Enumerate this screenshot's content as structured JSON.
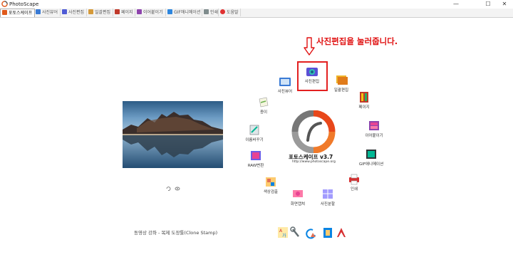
{
  "window": {
    "title": "PhotoScape"
  },
  "tabs": [
    {
      "label": "포토스케이프",
      "icon": "home-icon",
      "color": "#e05a1c"
    },
    {
      "label": "사진뷰어",
      "icon": "viewer-icon",
      "color": "#3a7bd5"
    },
    {
      "label": "사진편집",
      "icon": "editor-icon",
      "color": "#4f5bd5"
    },
    {
      "label": "일괄편집",
      "icon": "batch-icon",
      "color": "#d59a3a"
    },
    {
      "label": "페이지",
      "icon": "page-icon",
      "color": "#c0392b"
    },
    {
      "label": "이어붙이기",
      "icon": "combine-icon",
      "color": "#8e44ad"
    },
    {
      "label": "GIF애니메이션",
      "icon": "gif-icon",
      "color": "#2e86de"
    },
    {
      "label": "인쇄",
      "icon": "print-icon",
      "color": "#7f8c8d"
    },
    {
      "label": "도움말",
      "icon": "help-icon",
      "color": "#e03131"
    }
  ],
  "annotation": {
    "text": "사진편집을 눌러줍니다.",
    "color": "#e01010"
  },
  "center": {
    "title": "포토스케이프 v3.7",
    "url": "http://www.photoscape.org"
  },
  "wheel_items": [
    {
      "key": "viewer",
      "label": "사진뷰어",
      "icon": "viewer-icon"
    },
    {
      "key": "editor",
      "label": "사진편집",
      "icon": "photo-editor-icon"
    },
    {
      "key": "batch",
      "label": "일괄편집",
      "icon": "batch-editor-icon"
    },
    {
      "key": "page",
      "label": "페이지",
      "icon": "page-icon"
    },
    {
      "key": "combine",
      "label": "이어붙이기",
      "icon": "combine-icon"
    },
    {
      "key": "gif",
      "label": "GIF애니메이션",
      "icon": "gif-animation-icon"
    },
    {
      "key": "print",
      "label": "인쇄",
      "icon": "print-icon"
    },
    {
      "key": "splitter",
      "label": "사진분할",
      "icon": "splitter-icon"
    },
    {
      "key": "screen",
      "label": "화면캡쳐",
      "icon": "screen-capture-icon"
    },
    {
      "key": "color",
      "label": "색상검출",
      "icon": "color-picker-icon"
    },
    {
      "key": "raw",
      "label": "RAW변환",
      "icon": "raw-converter-icon"
    },
    {
      "key": "rename",
      "label": "이름바꾸기",
      "icon": "rename-icon"
    },
    {
      "key": "paper",
      "label": "종이",
      "icon": "paper-print-icon"
    }
  ],
  "status": {
    "text": "동영상 강좌 - 복제 도장툴(Clone Stamp)"
  },
  "bottom_icons": [
    "font-icon",
    "tools-icon",
    "refresh-icon",
    "settings-icon",
    "adobe-icon"
  ]
}
